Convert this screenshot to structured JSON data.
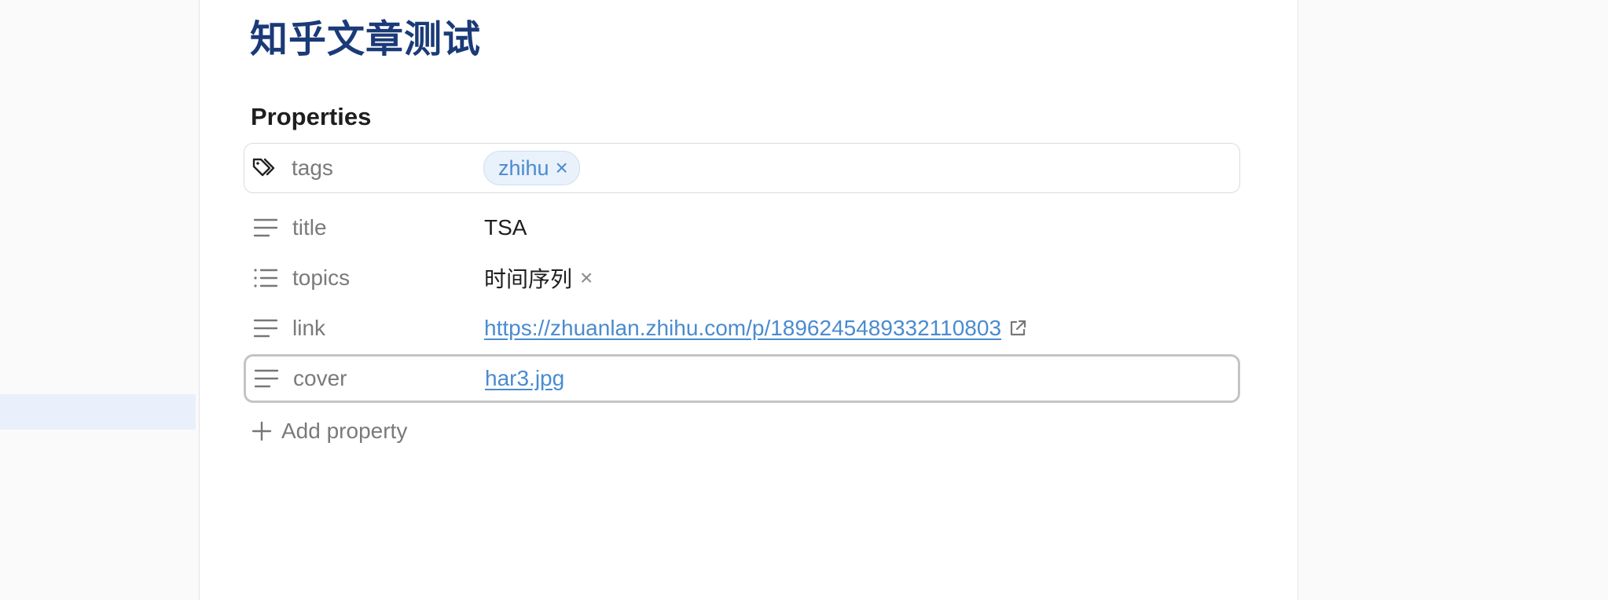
{
  "note": {
    "title": "知乎文章测试",
    "properties_heading": "Properties",
    "properties": [
      {
        "key": "tags",
        "icon": "tags-icon",
        "type": "tags",
        "tags": [
          "zhihu"
        ],
        "remove_glyph": "×"
      },
      {
        "key": "title",
        "icon": "text-icon",
        "type": "text",
        "value": "TSA"
      },
      {
        "key": "topics",
        "icon": "list-icon",
        "type": "list",
        "items": [
          "时间序列"
        ],
        "remove_glyph": "×"
      },
      {
        "key": "link",
        "icon": "text-icon",
        "type": "link",
        "value": "https://zhuanlan.zhihu.com/p/1896245489332110803"
      },
      {
        "key": "cover",
        "icon": "text-icon",
        "type": "link",
        "value": "har3.jpg"
      }
    ],
    "add_property_label": "Add property"
  },
  "colors": {
    "title": "#1a3a78",
    "link": "#4a8bd0",
    "tag_background": "#e9f1fb",
    "muted_text": "#7a7a7a"
  }
}
